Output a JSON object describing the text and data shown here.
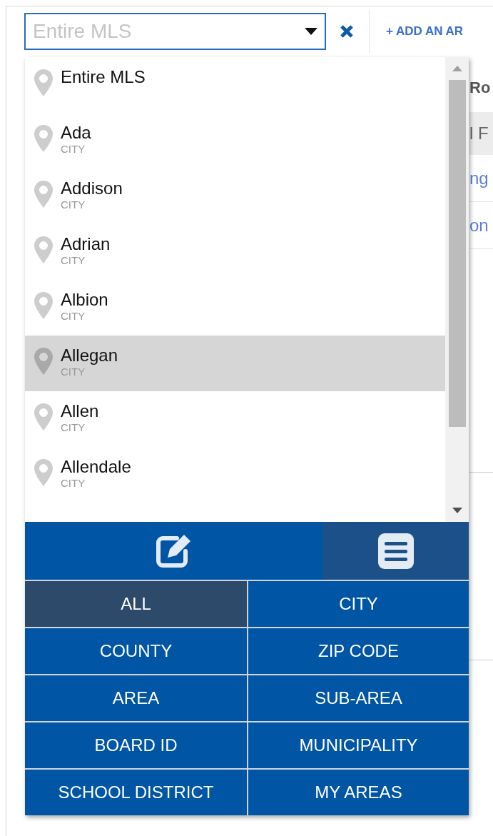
{
  "search": {
    "placeholder": "Entire MLS"
  },
  "add_area_link": "+ ADD AN AR",
  "background": {
    "heading": "Ro",
    "row": "l F",
    "links": [
      "ng",
      "on"
    ]
  },
  "results": [
    {
      "name": "Entire MLS",
      "selected": false
    },
    {
      "name": "Ada",
      "type": "CITY",
      "selected": false
    },
    {
      "name": "Addison",
      "type": "CITY",
      "selected": false
    },
    {
      "name": "Adrian",
      "type": "CITY",
      "selected": false
    },
    {
      "name": "Albion",
      "type": "CITY",
      "selected": false
    },
    {
      "name": "Allegan",
      "type": "CITY",
      "selected": true
    },
    {
      "name": "Allen",
      "type": "CITY",
      "selected": false
    },
    {
      "name": "Allendale",
      "type": "CITY",
      "selected": false
    }
  ],
  "view_modes": [
    {
      "kind": "edit",
      "selected": false
    },
    {
      "kind": "list",
      "selected": true
    }
  ],
  "filters": [
    {
      "label": "ALL",
      "selected": true
    },
    {
      "label": "CITY",
      "selected": false
    },
    {
      "label": "COUNTY",
      "selected": false
    },
    {
      "label": "ZIP CODE",
      "selected": false
    },
    {
      "label": "AREA",
      "selected": false
    },
    {
      "label": "SUB-AREA",
      "selected": false
    },
    {
      "label": "BOARD ID",
      "selected": false
    },
    {
      "label": "MUNICIPALITY",
      "selected": false
    },
    {
      "label": "SCHOOL DISTRICT",
      "selected": false
    },
    {
      "label": "MY AREAS",
      "selected": false
    }
  ]
}
